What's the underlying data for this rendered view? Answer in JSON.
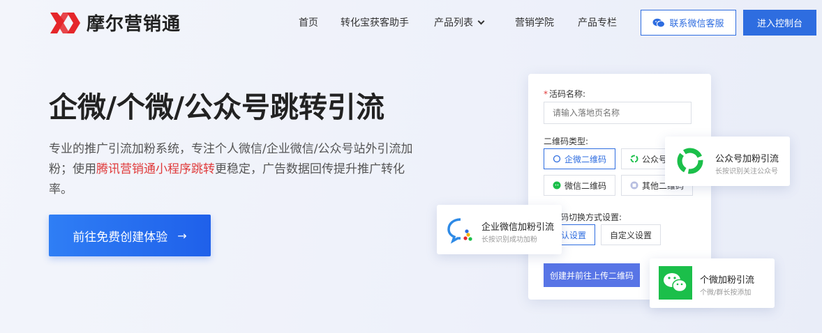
{
  "brand": {
    "name": "摩尔营销通",
    "color": "#e5262a"
  },
  "nav": {
    "items": [
      "首页",
      "转化宝获客助手",
      "产品列表",
      "营销学院",
      "产品专栏"
    ],
    "wechat_service": "联系微信客服",
    "console": "进入控制台"
  },
  "hero": {
    "title": "企微/个微/公众号跳转引流",
    "desc_part1": "专业的推广引流加粉系统，专注个人微信/企业微信/公众号站外引流加粉；使用",
    "desc_highlight": "腾讯营销通小程序跳转",
    "desc_part2": "更稳定，广告数据回传提升推广转化率。",
    "cta": "前往免费创建体验",
    "cta_arrow": "→"
  },
  "form": {
    "required_mark": "*",
    "name_label": "活码名称:",
    "name_placeholder": "请输入落地页名称",
    "type_label": "二维码类型:",
    "types": [
      "企微二维码",
      "公众号",
      "微信二维码",
      "其他二维码"
    ],
    "switch_label": "二维码切换方式设置:",
    "switch_options": [
      "默认设置",
      "自定义设置"
    ],
    "submit": "创建并前往上传二维码"
  },
  "floating": {
    "official": {
      "title": "公众号加粉引流",
      "subtitle": "长按识别关注公众号"
    },
    "wecom": {
      "title": "企业微信加粉引流",
      "subtitle": "长按识别成功加粉"
    },
    "personal": {
      "title": "个微加粉引流",
      "subtitle": "个微/群长按添加"
    }
  },
  "colors": {
    "primary": "#2e6de0",
    "highlight": "#e03a3a",
    "wechat_green": "#1bbf4a",
    "submit": "#5875e6"
  }
}
